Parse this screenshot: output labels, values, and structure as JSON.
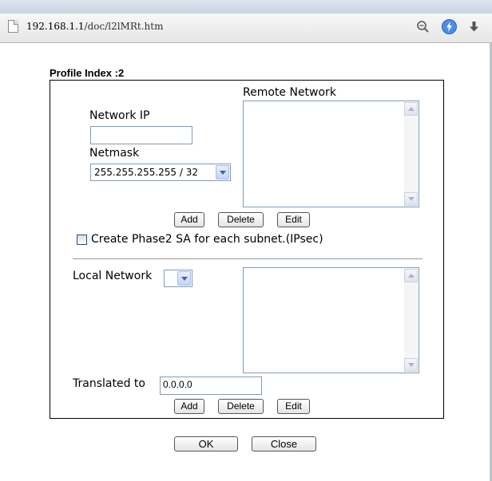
{
  "browser": {
    "url_host": "192.168.1.1",
    "url_path": "/doc/l2lMRt.htm"
  },
  "profile": {
    "label": "Profile Index :2"
  },
  "remote": {
    "title": "Remote Network",
    "network_ip_label": "Network IP",
    "network_ip_value": "",
    "netmask_label": "Netmask",
    "netmask_value": "255.255.255.255 / 32",
    "add": "Add",
    "delete": "Delete",
    "edit": "Edit",
    "phase2_label": "Create Phase2 SA for each subnet.(IPsec)"
  },
  "local": {
    "label": "Local Network",
    "selected": "",
    "translated_label": "Translated to",
    "translated_value": "0.0.0.0",
    "add": "Add",
    "delete": "Delete",
    "edit": "Edit"
  },
  "footer": {
    "ok": "OK",
    "close": "Close"
  },
  "icons": [
    "page-icon",
    "search-icon",
    "bolt-icon",
    "download-icon",
    "scroll-up-icon",
    "scroll-down-icon",
    "dropdown-arrow-icon"
  ]
}
